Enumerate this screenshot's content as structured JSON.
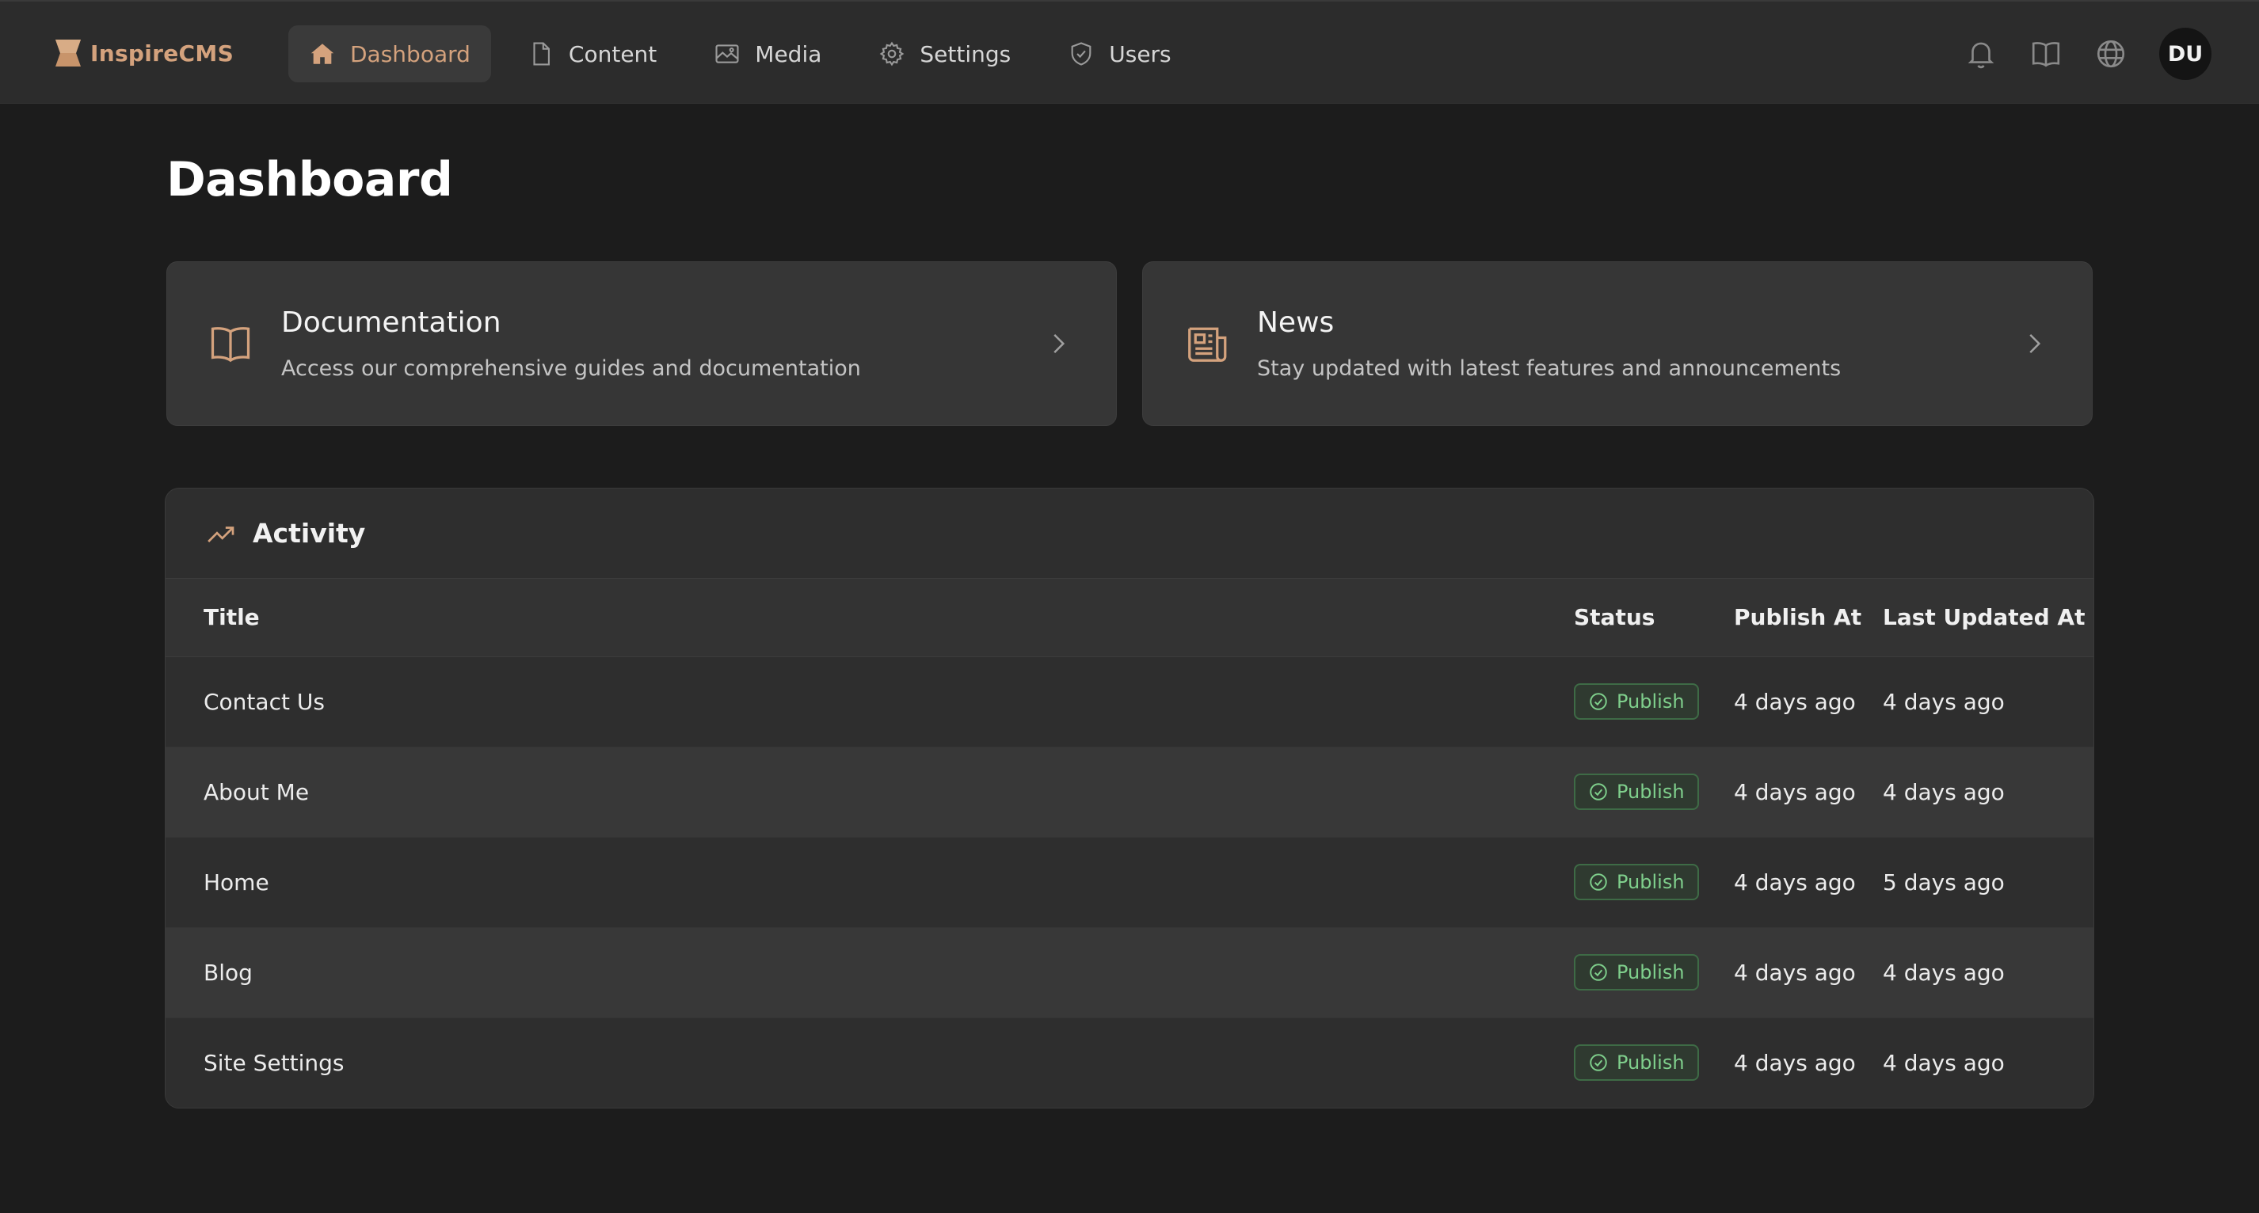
{
  "app": {
    "name": "InspireCMS"
  },
  "nav": {
    "items": [
      {
        "label": "Dashboard",
        "icon": "home-icon",
        "active": true
      },
      {
        "label": "Content",
        "icon": "document-icon"
      },
      {
        "label": "Media",
        "icon": "image-icon"
      },
      {
        "label": "Settings",
        "icon": "gear-icon"
      },
      {
        "label": "Users",
        "icon": "shield-icon"
      }
    ]
  },
  "topbar": {
    "icons": [
      "bell-icon",
      "book-icon",
      "globe-icon"
    ],
    "avatar_initials": "DU"
  },
  "page": {
    "title": "Dashboard"
  },
  "cards": [
    {
      "title": "Documentation",
      "description": "Access our comprehensive guides and documentation",
      "icon": "book-open-icon"
    },
    {
      "title": "News",
      "description": "Stay updated with latest features and announcements",
      "icon": "newspaper-icon"
    }
  ],
  "activity": {
    "title": "Activity",
    "columns": {
      "title": "Title",
      "status": "Status",
      "publish_at": "Publish At",
      "last_updated_at": "Last Updated At"
    },
    "rows": [
      {
        "title": "Contact Us",
        "status": "Publish",
        "publish_at": "4 days ago",
        "last_updated_at": "4 days ago"
      },
      {
        "title": "About Me",
        "status": "Publish",
        "publish_at": "4 days ago",
        "last_updated_at": "4 days ago"
      },
      {
        "title": "Home",
        "status": "Publish",
        "publish_at": "4 days ago",
        "last_updated_at": "5 days ago"
      },
      {
        "title": "Blog",
        "status": "Publish",
        "publish_at": "4 days ago",
        "last_updated_at": "4 days ago"
      },
      {
        "title": "Site Settings",
        "status": "Publish",
        "publish_at": "4 days ago",
        "last_updated_at": "4 days ago"
      }
    ]
  },
  "colors": {
    "accent": "#d4a27d",
    "status_publish": "#7fcf8c",
    "topbar_bg": "#2c2c2c",
    "page_bg": "#1c1c1c"
  }
}
